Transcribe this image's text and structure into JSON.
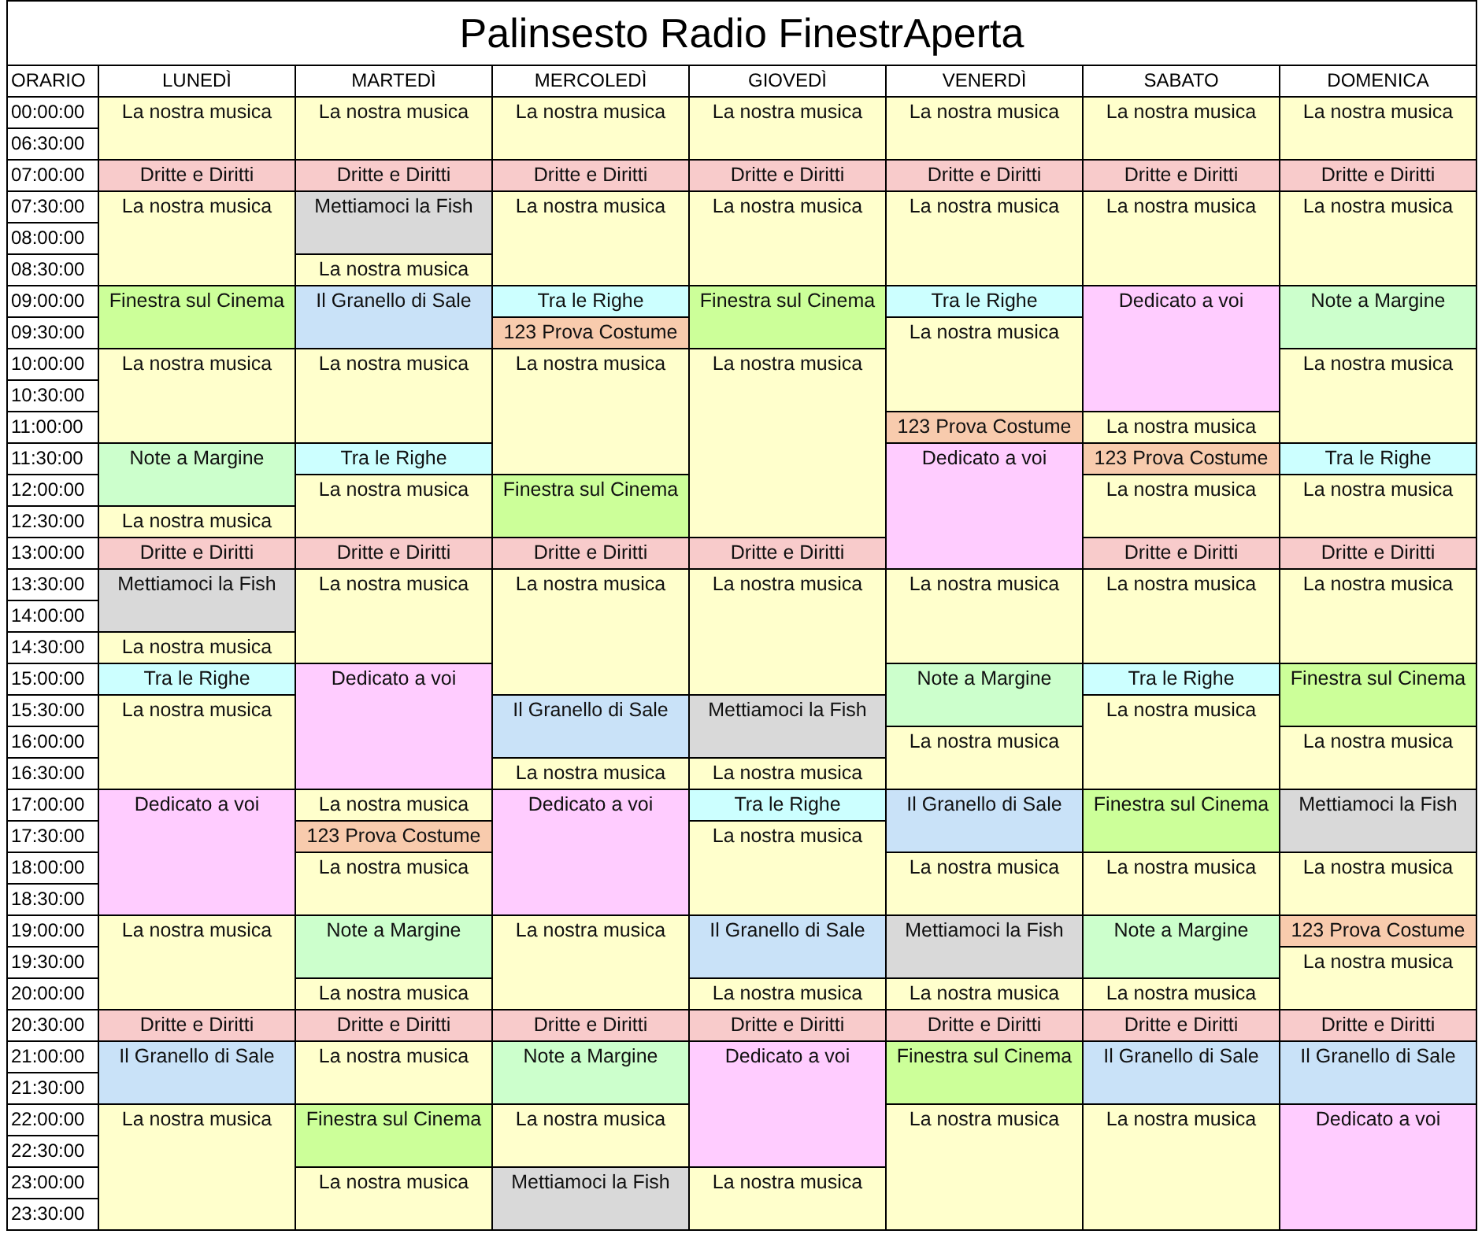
{
  "title": "Palinsesto Radio FinestrAperta",
  "time_header": "ORARIO",
  "times": [
    "00:00:00",
    "06:30:00",
    "07:00:00",
    "07:30:00",
    "08:00:00",
    "08:30:00",
    "09:00:00",
    "09:30:00",
    "10:00:00",
    "10:30:00",
    "11:00:00",
    "11:30:00",
    "12:00:00",
    "12:30:00",
    "13:00:00",
    "13:30:00",
    "14:00:00",
    "14:30:00",
    "15:00:00",
    "15:30:00",
    "16:00:00",
    "16:30:00",
    "17:00:00",
    "17:30:00",
    "18:00:00",
    "18:30:00",
    "19:00:00",
    "19:30:00",
    "20:00:00",
    "20:30:00",
    "21:00:00",
    "21:30:00",
    "22:00:00",
    "22:30:00",
    "23:00:00",
    "23:30:00"
  ],
  "days": [
    {
      "name": "LUNEDÌ",
      "slots": [
        {
          "merged": false,
          "title": "La nostra musica",
          "color": "#ffffcc"
        },
        {
          "merged": true
        },
        {
          "merged": false,
          "title": "Dritte e Diritti",
          "color": "#f8cbcb"
        },
        {
          "merged": false,
          "title": "La nostra musica",
          "color": "#ffffcc"
        },
        {
          "merged": true
        },
        {
          "merged": true
        },
        {
          "merged": false,
          "title": "Finestra sul Cinema",
          "color": "#ccff99"
        },
        {
          "merged": true
        },
        {
          "merged": false,
          "title": "La nostra musica",
          "color": "#ffffcc"
        },
        {
          "merged": true
        },
        {
          "merged": true
        },
        {
          "merged": false,
          "title": "Note a Margine",
          "color": "#ccffcc"
        },
        {
          "merged": true
        },
        {
          "merged": false,
          "title": "La nostra musica",
          "color": "#ffffcc"
        },
        {
          "merged": false,
          "title": "Dritte e Diritti",
          "color": "#f8cbcb"
        },
        {
          "merged": false,
          "title": "Mettiamoci la Fish",
          "color": "#d9d9d9"
        },
        {
          "merged": true
        },
        {
          "merged": false,
          "title": "La nostra musica",
          "color": "#ffffcc"
        },
        {
          "merged": false,
          "title": "Tra le Righe",
          "color": "#ccffff"
        },
        {
          "merged": false,
          "title": "La nostra musica",
          "color": "#ffffcc"
        },
        {
          "merged": true
        },
        {
          "merged": true
        },
        {
          "merged": false,
          "title": "Dedicato a voi",
          "color": "#ffccff"
        },
        {
          "merged": true
        },
        {
          "merged": true
        },
        {
          "merged": true
        },
        {
          "merged": false,
          "title": "La nostra musica",
          "color": "#ffffcc"
        },
        {
          "merged": true
        },
        {
          "merged": true
        },
        {
          "merged": false,
          "title": "Dritte e Diritti",
          "color": "#f8cbcb"
        },
        {
          "merged": false,
          "title": "Il Granello di Sale",
          "color": "#c9e2f8"
        },
        {
          "merged": true
        },
        {
          "merged": false,
          "title": "La nostra musica",
          "color": "#ffffcc"
        },
        {
          "merged": true
        },
        {
          "merged": true
        },
        {
          "merged": true
        }
      ]
    },
    {
      "name": "MARTEDÌ",
      "slots": [
        {
          "merged": false,
          "title": "La nostra musica",
          "color": "#ffffcc"
        },
        {
          "merged": true
        },
        {
          "merged": false,
          "title": "Dritte e Diritti",
          "color": "#f8cbcb"
        },
        {
          "merged": false,
          "title": "Mettiamoci la Fish",
          "color": "#d9d9d9"
        },
        {
          "merged": true
        },
        {
          "merged": false,
          "title": "La nostra musica",
          "color": "#ffffcc"
        },
        {
          "merged": false,
          "title": "Il Granello di Sale",
          "color": "#c9e2f8"
        },
        {
          "merged": true
        },
        {
          "merged": false,
          "title": "La nostra musica",
          "color": "#ffffcc"
        },
        {
          "merged": true
        },
        {
          "merged": true
        },
        {
          "merged": false,
          "title": "Tra le Righe",
          "color": "#ccffff"
        },
        {
          "merged": false,
          "title": "La nostra musica",
          "color": "#ffffcc"
        },
        {
          "merged": true
        },
        {
          "merged": false,
          "title": "Dritte e Diritti",
          "color": "#f8cbcb"
        },
        {
          "merged": false,
          "title": "La nostra musica",
          "color": "#ffffcc"
        },
        {
          "merged": true
        },
        {
          "merged": true
        },
        {
          "merged": false,
          "title": "Dedicato a voi",
          "color": "#ffccff"
        },
        {
          "merged": true
        },
        {
          "merged": true
        },
        {
          "merged": true
        },
        {
          "merged": false,
          "title": "La nostra musica",
          "color": "#ffffcc"
        },
        {
          "merged": false,
          "title": "123 Prova Costume",
          "color": "#f8cbad"
        },
        {
          "merged": false,
          "title": "La nostra musica",
          "color": "#ffffcc"
        },
        {
          "merged": true
        },
        {
          "merged": false,
          "title": "Note a Margine",
          "color": "#ccffcc"
        },
        {
          "merged": true
        },
        {
          "merged": false,
          "title": "La nostra musica",
          "color": "#ffffcc"
        },
        {
          "merged": false,
          "title": "Dritte e Diritti",
          "color": "#f8cbcb"
        },
        {
          "merged": false,
          "title": "La nostra musica",
          "color": "#ffffcc"
        },
        {
          "merged": true
        },
        {
          "merged": false,
          "title": "Finestra sul Cinema",
          "color": "#ccff99"
        },
        {
          "merged": true
        },
        {
          "merged": false,
          "title": "La nostra musica",
          "color": "#ffffcc"
        },
        {
          "merged": true
        }
      ]
    },
    {
      "name": "MERCOLEDÌ",
      "slots": [
        {
          "merged": false,
          "title": "La nostra musica",
          "color": "#ffffcc"
        },
        {
          "merged": true
        },
        {
          "merged": false,
          "title": "Dritte e Diritti",
          "color": "#f8cbcb"
        },
        {
          "merged": false,
          "title": "La nostra musica",
          "color": "#ffffcc"
        },
        {
          "merged": true
        },
        {
          "merged": true
        },
        {
          "merged": false,
          "title": "Tra le Righe",
          "color": "#ccffff"
        },
        {
          "merged": false,
          "title": "123 Prova Costume",
          "color": "#f8cbad"
        },
        {
          "merged": false,
          "title": "La nostra musica",
          "color": "#ffffcc"
        },
        {
          "merged": true
        },
        {
          "merged": true
        },
        {
          "merged": true
        },
        {
          "merged": false,
          "title": "Finestra sul Cinema",
          "color": "#ccff99"
        },
        {
          "merged": true
        },
        {
          "merged": false,
          "title": "Dritte e Diritti",
          "color": "#f8cbcb"
        },
        {
          "merged": false,
          "title": "La nostra musica",
          "color": "#ffffcc"
        },
        {
          "merged": true
        },
        {
          "merged": true
        },
        {
          "merged": true
        },
        {
          "merged": false,
          "title": "Il Granello di Sale",
          "color": "#c9e2f8"
        },
        {
          "merged": true
        },
        {
          "merged": false,
          "title": "La nostra musica",
          "color": "#ffffcc"
        },
        {
          "merged": false,
          "title": "Dedicato a voi",
          "color": "#ffccff"
        },
        {
          "merged": true
        },
        {
          "merged": true
        },
        {
          "merged": true
        },
        {
          "merged": false,
          "title": "La nostra musica",
          "color": "#ffffcc"
        },
        {
          "merged": true
        },
        {
          "merged": true
        },
        {
          "merged": false,
          "title": "Dritte e Diritti",
          "color": "#f8cbcb"
        },
        {
          "merged": false,
          "title": "Note a Margine",
          "color": "#ccffcc"
        },
        {
          "merged": true
        },
        {
          "merged": false,
          "title": "La nostra musica",
          "color": "#ffffcc"
        },
        {
          "merged": true
        },
        {
          "merged": false,
          "title": "Mettiamoci la Fish",
          "color": "#d9d9d9"
        },
        {
          "merged": true
        }
      ]
    },
    {
      "name": "GIOVEDÌ",
      "slots": [
        {
          "merged": false,
          "title": "La nostra musica",
          "color": "#ffffcc"
        },
        {
          "merged": true
        },
        {
          "merged": false,
          "title": "Dritte e Diritti",
          "color": "#f8cbcb"
        },
        {
          "merged": false,
          "title": "La nostra musica",
          "color": "#ffffcc"
        },
        {
          "merged": true
        },
        {
          "merged": true
        },
        {
          "merged": false,
          "title": "Finestra sul Cinema",
          "color": "#ccff99"
        },
        {
          "merged": true
        },
        {
          "merged": false,
          "title": "La nostra musica",
          "color": "#ffffcc"
        },
        {
          "merged": true
        },
        {
          "merged": true
        },
        {
          "merged": true
        },
        {
          "merged": true
        },
        {
          "merged": true
        },
        {
          "merged": false,
          "title": "Dritte e Diritti",
          "color": "#f8cbcb"
        },
        {
          "merged": false,
          "title": "La nostra musica",
          "color": "#ffffcc"
        },
        {
          "merged": true
        },
        {
          "merged": true
        },
        {
          "merged": true
        },
        {
          "merged": false,
          "title": "Mettiamoci la Fish",
          "color": "#d9d9d9"
        },
        {
          "merged": true
        },
        {
          "merged": false,
          "title": "La nostra musica",
          "color": "#ffffcc"
        },
        {
          "merged": false,
          "title": "Tra le Righe",
          "color": "#ccffff"
        },
        {
          "merged": false,
          "title": "La nostra musica",
          "color": "#ffffcc"
        },
        {
          "merged": true
        },
        {
          "merged": true
        },
        {
          "merged": false,
          "title": "Il Granello di Sale",
          "color": "#c9e2f8"
        },
        {
          "merged": true
        },
        {
          "merged": false,
          "title": "La nostra musica",
          "color": "#ffffcc"
        },
        {
          "merged": false,
          "title": "Dritte e Diritti",
          "color": "#f8cbcb"
        },
        {
          "merged": false,
          "title": "Dedicato a voi",
          "color": "#ffccff"
        },
        {
          "merged": true
        },
        {
          "merged": true
        },
        {
          "merged": true
        },
        {
          "merged": false,
          "title": "La nostra musica",
          "color": "#ffffcc"
        },
        {
          "merged": true
        }
      ]
    },
    {
      "name": "VENERDÌ",
      "slots": [
        {
          "merged": false,
          "title": "La nostra musica",
          "color": "#ffffcc"
        },
        {
          "merged": true
        },
        {
          "merged": false,
          "title": "Dritte e Diritti",
          "color": "#f8cbcb"
        },
        {
          "merged": false,
          "title": "La nostra musica",
          "color": "#ffffcc"
        },
        {
          "merged": true
        },
        {
          "merged": true
        },
        {
          "merged": false,
          "title": "Tra le Righe",
          "color": "#ccffff"
        },
        {
          "merged": false,
          "title": "La nostra musica",
          "color": "#ffffcc"
        },
        {
          "merged": true
        },
        {
          "merged": true
        },
        {
          "merged": false,
          "title": "123 Prova Costume",
          "color": "#f8cbad"
        },
        {
          "merged": false,
          "title": "Dedicato a voi",
          "color": "#ffccff"
        },
        {
          "merged": true
        },
        {
          "merged": true
        },
        {
          "merged": true
        },
        {
          "merged": false,
          "title": "La nostra musica",
          "color": "#ffffcc"
        },
        {
          "merged": true
        },
        {
          "merged": true
        },
        {
          "merged": false,
          "title": "Note a Margine",
          "color": "#ccffcc"
        },
        {
          "merged": true
        },
        {
          "merged": false,
          "title": "La nostra musica",
          "color": "#ffffcc"
        },
        {
          "merged": true
        },
        {
          "merged": false,
          "title": "Il Granello di Sale",
          "color": "#c9e2f8"
        },
        {
          "merged": true
        },
        {
          "merged": false,
          "title": "La nostra musica",
          "color": "#ffffcc"
        },
        {
          "merged": true
        },
        {
          "merged": false,
          "title": "Mettiamoci la Fish",
          "color": "#d9d9d9"
        },
        {
          "merged": true
        },
        {
          "merged": false,
          "title": "La nostra musica",
          "color": "#ffffcc"
        },
        {
          "merged": false,
          "title": "Dritte e Diritti",
          "color": "#f8cbcb"
        },
        {
          "merged": false,
          "title": "Finestra sul Cinema",
          "color": "#ccff99"
        },
        {
          "merged": true
        },
        {
          "merged": false,
          "title": "La nostra musica",
          "color": "#ffffcc"
        },
        {
          "merged": true
        },
        {
          "merged": true
        },
        {
          "merged": true
        }
      ]
    },
    {
      "name": "SABATO",
      "slots": [
        {
          "merged": false,
          "title": "La nostra musica",
          "color": "#ffffcc"
        },
        {
          "merged": true
        },
        {
          "merged": false,
          "title": "Dritte e Diritti",
          "color": "#f8cbcb"
        },
        {
          "merged": false,
          "title": "La nostra musica",
          "color": "#ffffcc"
        },
        {
          "merged": true
        },
        {
          "merged": true
        },
        {
          "merged": false,
          "title": "Dedicato a voi",
          "color": "#ffccff"
        },
        {
          "merged": true
        },
        {
          "merged": true
        },
        {
          "merged": true
        },
        {
          "merged": false,
          "title": "La nostra musica",
          "color": "#ffffcc"
        },
        {
          "merged": false,
          "title": "123 Prova Costume",
          "color": "#f8cbad"
        },
        {
          "merged": false,
          "title": "La nostra musica",
          "color": "#ffffcc"
        },
        {
          "merged": true
        },
        {
          "merged": false,
          "title": "Dritte e Diritti",
          "color": "#f8cbcb"
        },
        {
          "merged": false,
          "title": "La nostra musica",
          "color": "#ffffcc"
        },
        {
          "merged": true
        },
        {
          "merged": true
        },
        {
          "merged": false,
          "title": "Tra le Righe",
          "color": "#ccffff"
        },
        {
          "merged": false,
          "title": "La nostra musica",
          "color": "#ffffcc"
        },
        {
          "merged": true
        },
        {
          "merged": true
        },
        {
          "merged": false,
          "title": "Finestra sul Cinema",
          "color": "#ccff99"
        },
        {
          "merged": true
        },
        {
          "merged": false,
          "title": "La nostra musica",
          "color": "#ffffcc"
        },
        {
          "merged": true
        },
        {
          "merged": false,
          "title": "Note a Margine",
          "color": "#ccffcc"
        },
        {
          "merged": true
        },
        {
          "merged": false,
          "title": "La nostra musica",
          "color": "#ffffcc"
        },
        {
          "merged": false,
          "title": "Dritte e Diritti",
          "color": "#f8cbcb"
        },
        {
          "merged": false,
          "title": "Il Granello di Sale",
          "color": "#c9e2f8"
        },
        {
          "merged": true
        },
        {
          "merged": false,
          "title": "La nostra musica",
          "color": "#ffffcc"
        },
        {
          "merged": true
        },
        {
          "merged": true
        },
        {
          "merged": true
        }
      ]
    },
    {
      "name": "DOMENICA",
      "slots": [
        {
          "merged": false,
          "title": "La nostra musica",
          "color": "#ffffcc"
        },
        {
          "merged": true
        },
        {
          "merged": false,
          "title": "Dritte e Diritti",
          "color": "#f8cbcb"
        },
        {
          "merged": false,
          "title": "La nostra musica",
          "color": "#ffffcc"
        },
        {
          "merged": true
        },
        {
          "merged": true
        },
        {
          "merged": false,
          "title": "Note a Margine",
          "color": "#ccffcc"
        },
        {
          "merged": true
        },
        {
          "merged": false,
          "title": "La nostra musica",
          "color": "#ffffcc"
        },
        {
          "merged": true
        },
        {
          "merged": true
        },
        {
          "merged": false,
          "title": "Tra le Righe",
          "color": "#ccffff"
        },
        {
          "merged": false,
          "title": "La nostra musica",
          "color": "#ffffcc"
        },
        {
          "merged": true
        },
        {
          "merged": false,
          "title": "Dritte e Diritti",
          "color": "#f8cbcb"
        },
        {
          "merged": false,
          "title": "La nostra musica",
          "color": "#ffffcc"
        },
        {
          "merged": true
        },
        {
          "merged": true
        },
        {
          "merged": false,
          "title": "Finestra sul Cinema",
          "color": "#ccff99"
        },
        {
          "merged": true
        },
        {
          "merged": false,
          "title": "La nostra musica",
          "color": "#ffffcc"
        },
        {
          "merged": true
        },
        {
          "merged": false,
          "title": "Mettiamoci la Fish",
          "color": "#d9d9d9"
        },
        {
          "merged": true
        },
        {
          "merged": false,
          "title": "La nostra musica",
          "color": "#ffffcc"
        },
        {
          "merged": true
        },
        {
          "merged": false,
          "title": "123 Prova Costume",
          "color": "#f8cbad"
        },
        {
          "merged": false,
          "title": "La nostra musica",
          "color": "#ffffcc"
        },
        {
          "merged": true
        },
        {
          "merged": false,
          "title": "Dritte e Diritti",
          "color": "#f8cbcb"
        },
        {
          "merged": false,
          "title": "Il Granello di Sale",
          "color": "#c9e2f8"
        },
        {
          "merged": true
        },
        {
          "merged": false,
          "title": "Dedicato a voi",
          "color": "#ffccff"
        },
        {
          "merged": true
        },
        {
          "merged": true
        },
        {
          "merged": true
        }
      ]
    }
  ]
}
